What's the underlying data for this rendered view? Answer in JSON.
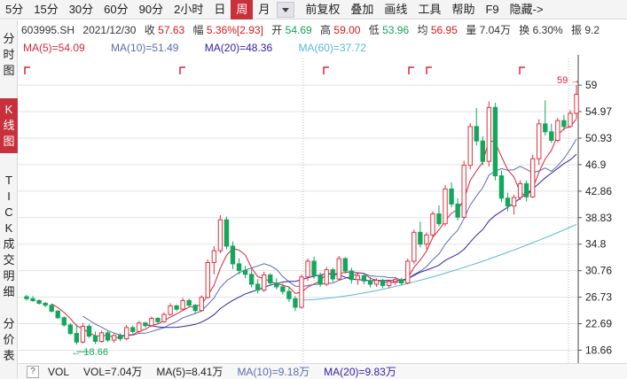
{
  "toolbar": {
    "periods": [
      "5分",
      "15分",
      "30分",
      "60分",
      "90分",
      "2小时",
      "日",
      "周",
      "月"
    ],
    "active_period": "周",
    "tools": [
      "前复权",
      "叠加",
      "画线",
      "工具",
      "帮助",
      "F9",
      "隐藏->"
    ]
  },
  "sidebar": {
    "fenshi": "分时图",
    "kline": "K线图",
    "tick": "TICK",
    "deals": "成交明细",
    "price_table": "分价表"
  },
  "quote": {
    "code": "603995.SH",
    "date": "2021/12/30",
    "close_label": "收",
    "close": "57.63",
    "change_label": "幅",
    "change": "5.36%[2.93]",
    "open_label": "开",
    "open": "54.69",
    "high_label": "高",
    "high": "59.00",
    "low_label": "低",
    "low": "53.96",
    "avg_label": "均",
    "avg": "56.95",
    "volume_label": "量",
    "volume": "7.04万",
    "turnover_label": "换",
    "turnover": "6.30%",
    "amplitude_label": "振",
    "amplitude": "9.2"
  },
  "ma": {
    "ma5": "MA(5)=54.09",
    "ma10": "MA(10)=51.49",
    "ma20": "MA(20)=48.36",
    "ma60": "MA(60)=37.72"
  },
  "colors": {
    "up": "#e03241",
    "down": "#13a65c",
    "ma5": "#d8263b",
    "ma10": "#5a6bb0",
    "ma20": "#3320a8",
    "ma60": "#5ab8d8",
    "active": "#c8303b"
  },
  "chart_data": {
    "type": "candlestick",
    "y_ticks": [
      "59",
      "54.97",
      "50.93",
      "46.9",
      "42.86",
      "38.83",
      "34.8",
      "30.76",
      "26.73",
      "22.69",
      "18.66"
    ],
    "ylim": [
      16.7,
      63.6
    ],
    "high_mark": "59",
    "low_mark": "18.66",
    "candles": [
      [
        26.8,
        27.1,
        26.2,
        26.5
      ],
      [
        26.5,
        26.9,
        26.0,
        26.2
      ],
      [
        26.2,
        26.4,
        25.6,
        25.8
      ],
      [
        25.8,
        26.0,
        25.2,
        25.5
      ],
      [
        25.5,
        25.7,
        24.4,
        24.6
      ],
      [
        24.6,
        24.8,
        23.4,
        23.6
      ],
      [
        23.6,
        23.8,
        22.2,
        22.5
      ],
      [
        22.5,
        22.8,
        21.0,
        21.2
      ],
      [
        21.2,
        22.6,
        19.5,
        19.9
      ],
      [
        19.9,
        22.8,
        19.7,
        22.3
      ],
      [
        22.3,
        22.6,
        20.5,
        20.8
      ],
      [
        20.8,
        21.5,
        19.6,
        20.0
      ],
      [
        20.0,
        21.6,
        19.8,
        21.3
      ],
      [
        21.3,
        21.6,
        19.9,
        20.2
      ],
      [
        20.2,
        21.1,
        19.8,
        20.9
      ],
      [
        20.9,
        21.3,
        20.0,
        20.4
      ],
      [
        20.4,
        22.5,
        20.2,
        22.1
      ],
      [
        22.1,
        22.4,
        21.2,
        21.5
      ],
      [
        21.5,
        23.1,
        21.3,
        22.8
      ],
      [
        22.8,
        23.0,
        22.1,
        22.4
      ],
      [
        22.4,
        23.8,
        22.2,
        23.5
      ],
      [
        23.5,
        23.7,
        22.7,
        23.0
      ],
      [
        23.0,
        24.4,
        22.8,
        24.1
      ],
      [
        24.1,
        25.8,
        23.9,
        25.4
      ],
      [
        25.4,
        25.6,
        24.6,
        24.9
      ],
      [
        24.9,
        26.6,
        24.7,
        26.2
      ],
      [
        26.2,
        26.5,
        25.2,
        25.5
      ],
      [
        25.5,
        25.7,
        24.3,
        24.7
      ],
      [
        24.7,
        27.0,
        24.5,
        26.7
      ],
      [
        26.7,
        32.5,
        26.5,
        32.0
      ],
      [
        32.0,
        34.5,
        30.2,
        33.8
      ],
      [
        33.8,
        39.2,
        33.4,
        38.5
      ],
      [
        38.5,
        39.0,
        34.0,
        34.5
      ],
      [
        34.5,
        35.2,
        31.0,
        31.8
      ],
      [
        31.8,
        32.6,
        30.2,
        30.8
      ],
      [
        30.8,
        31.5,
        29.6,
        30.2
      ],
      [
        30.2,
        31.0,
        28.2,
        28.7
      ],
      [
        28.7,
        29.5,
        27.3,
        27.8
      ],
      [
        27.8,
        30.6,
        27.5,
        30.1
      ],
      [
        30.1,
        30.4,
        28.5,
        28.9
      ],
      [
        28.9,
        29.6,
        27.9,
        28.3
      ],
      [
        28.3,
        28.8,
        27.1,
        27.6
      ],
      [
        27.6,
        28.2,
        26.0,
        26.5
      ],
      [
        26.5,
        26.9,
        24.6,
        25.2
      ],
      [
        25.2,
        30.2,
        25.0,
        29.8
      ],
      [
        29.8,
        32.6,
        29.2,
        32.2
      ],
      [
        32.2,
        32.9,
        29.5,
        30.0
      ],
      [
        30.0,
        30.5,
        28.3,
        28.7
      ],
      [
        28.7,
        31.3,
        28.4,
        30.9
      ],
      [
        30.9,
        31.2,
        29.0,
        29.5
      ],
      [
        29.5,
        33.0,
        29.3,
        32.6
      ],
      [
        32.6,
        32.8,
        30.3,
        30.7
      ],
      [
        30.7,
        31.2,
        28.8,
        29.4
      ],
      [
        29.4,
        30.4,
        28.6,
        30.0
      ],
      [
        30.0,
        30.3,
        28.7,
        29.2
      ],
      [
        29.2,
        29.8,
        28.2,
        28.7
      ],
      [
        28.7,
        29.6,
        28.3,
        29.3
      ],
      [
        29.3,
        29.5,
        28.1,
        28.5
      ],
      [
        28.5,
        29.4,
        28.1,
        29.1
      ],
      [
        29.1,
        29.8,
        28.6,
        29.4
      ],
      [
        29.4,
        29.7,
        28.5,
        28.9
      ],
      [
        28.9,
        32.6,
        28.7,
        32.2
      ],
      [
        32.2,
        37.0,
        31.8,
        36.6
      ],
      [
        36.6,
        38.2,
        34.3,
        34.8
      ],
      [
        34.8,
        36.6,
        34.0,
        36.2
      ],
      [
        36.2,
        39.8,
        35.9,
        39.4
      ],
      [
        39.4,
        40.7,
        37.5,
        37.9
      ],
      [
        37.9,
        43.8,
        37.6,
        43.2
      ],
      [
        43.2,
        44.2,
        40.4,
        40.9
      ],
      [
        40.9,
        41.8,
        38.4,
        38.9
      ],
      [
        38.9,
        47.5,
        38.6,
        46.8
      ],
      [
        46.8,
        53.2,
        46.2,
        52.7
      ],
      [
        52.7,
        55.5,
        49.8,
        50.5
      ],
      [
        50.5,
        51.2,
        46.8,
        47.4
      ],
      [
        47.4,
        56.5,
        46.6,
        55.6
      ],
      [
        55.6,
        56.3,
        44.5,
        45.2
      ],
      [
        45.2,
        46.0,
        41.2,
        41.8
      ],
      [
        41.8,
        42.6,
        39.8,
        40.6
      ],
      [
        40.6,
        42.3,
        39.3,
        41.9
      ],
      [
        41.9,
        44.5,
        41.5,
        44.0
      ],
      [
        44.0,
        44.5,
        41.3,
        42.0
      ],
      [
        42.0,
        48.4,
        41.8,
        47.8
      ],
      [
        47.8,
        53.8,
        46.9,
        53.1
      ],
      [
        53.1,
        56.7,
        51.3,
        51.9
      ],
      [
        51.9,
        53.1,
        50.2,
        50.6
      ],
      [
        50.6,
        54.0,
        50.3,
        53.6
      ],
      [
        53.6,
        54.5,
        52.1,
        52.7
      ],
      [
        52.7,
        55.2,
        52.5,
        54.7
      ],
      [
        54.7,
        59.0,
        53.9,
        57.6
      ]
    ]
  },
  "volume_bar": {
    "help": "?",
    "vol_label": "VOL",
    "vol": "VOL=7.04万",
    "ma5": "MA(5)=8.41万",
    "ma10": "MA(10)=9.18万",
    "ma20": "MA(20)=9.83万"
  }
}
